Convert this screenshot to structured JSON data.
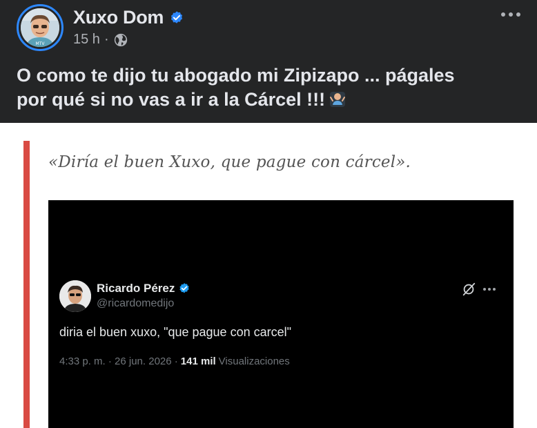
{
  "post": {
    "author_name": "Xuxo Dom",
    "timestamp": "15 h",
    "separator": "·",
    "privacy_icon": "globe-icon",
    "verified_icon": "verified-badge-icon",
    "more_icon": "more-options-icon",
    "text_line1": "O como te dijo tu abogado mi Zipizapo ... págales",
    "text_line2": "por qué si no vas a ir a la Cárcel !!!",
    "emoji": "person-shrugging-emoji"
  },
  "article": {
    "quote": "«Diría el buen Xuxo, que pague con cárcel».",
    "accent_color": "#d94a43"
  },
  "tweet": {
    "name": "Ricardo Pérez",
    "handle": "@ricardomedijo",
    "body": "diria el buen xuxo, \"que pague con carcel\"",
    "time": "4:33 p. m. · 26 jun. 2026 ·",
    "views_count": "141 mil",
    "views_label": "Visualizaciones",
    "grok_icon": "grok-icon",
    "more_icon": "more-options-icon"
  },
  "colors": {
    "post_background": "#242526",
    "verified_blue": "#2d88ff",
    "tweet_verified_blue": "#1d9bf0"
  }
}
